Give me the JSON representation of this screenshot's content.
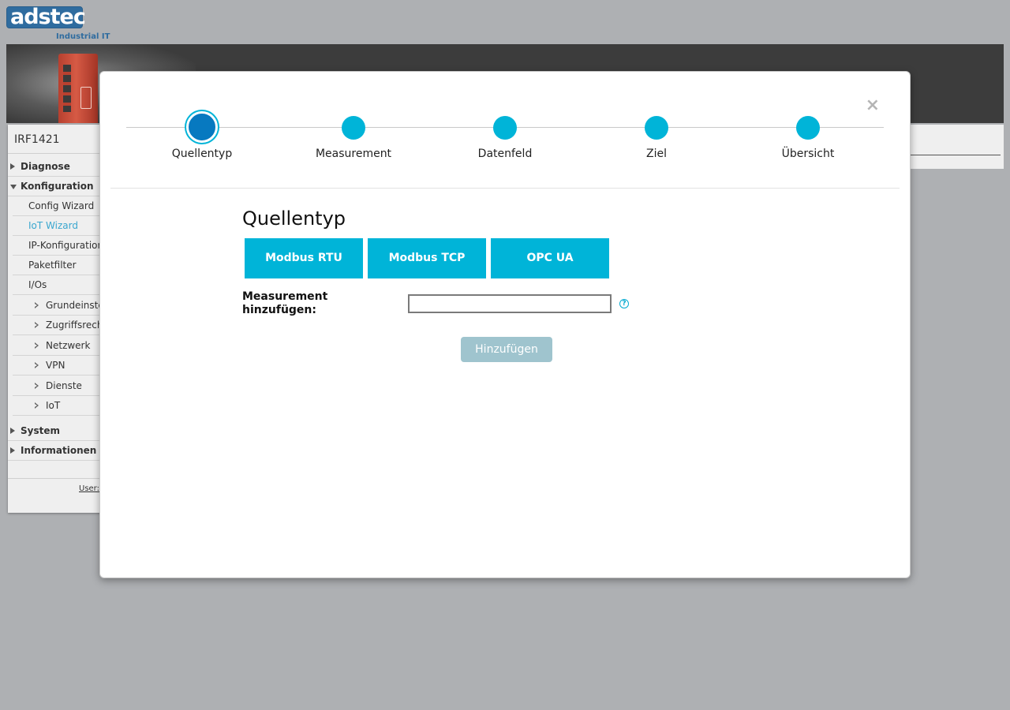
{
  "brand": {
    "logo_left": "ads",
    "logo_right": "tec",
    "subtitle": "Industrial IT"
  },
  "sidebar": {
    "device_name": "IRF1421",
    "items": [
      {
        "label": "Diagnose",
        "level": "top",
        "state": "collapsed"
      },
      {
        "label": "Konfiguration",
        "level": "top",
        "state": "expanded"
      },
      {
        "label": "Config Wizard",
        "level": "sub"
      },
      {
        "label": "IoT Wizard",
        "level": "sub",
        "active": true
      },
      {
        "label": "IP-Konfiguration",
        "level": "sub"
      },
      {
        "label": "Paketfilter",
        "level": "sub"
      },
      {
        "label": "I/Os",
        "level": "sub"
      },
      {
        "label": "Grundeinstellungen",
        "level": "subsub"
      },
      {
        "label": "Zugriffsrechte",
        "level": "subsub"
      },
      {
        "label": "Netzwerk",
        "level": "subsub"
      },
      {
        "label": "VPN",
        "level": "subsub"
      },
      {
        "label": "Dienste",
        "level": "subsub"
      },
      {
        "label": "IoT",
        "level": "subsub"
      },
      {
        "label": "System",
        "level": "top",
        "state": "collapsed"
      },
      {
        "label": "Informationen",
        "level": "top",
        "state": "collapsed"
      }
    ],
    "user_label": "User:"
  },
  "wizard": {
    "close_symbol": "×",
    "steps": [
      {
        "label": "Quellentyp",
        "active": true
      },
      {
        "label": "Measurement",
        "active": false
      },
      {
        "label": "Datenfeld",
        "active": false
      },
      {
        "label": "Ziel",
        "active": false
      },
      {
        "label": "Übersicht",
        "active": false
      }
    ],
    "section_title": "Quellentyp",
    "source_types": [
      "Modbus RTU",
      "Modbus TCP",
      "OPC UA"
    ],
    "measurement_label": "Measurement hinzufügen:",
    "measurement_value": "",
    "help_symbol": "?",
    "add_button": "Hinzufügen"
  },
  "colors": {
    "accent": "#00b4d8",
    "active_step": "#0779c0",
    "disabled_button": "#9fc4ce",
    "active_nav": "#3aa7cf",
    "brand": "#2f6c9f"
  }
}
